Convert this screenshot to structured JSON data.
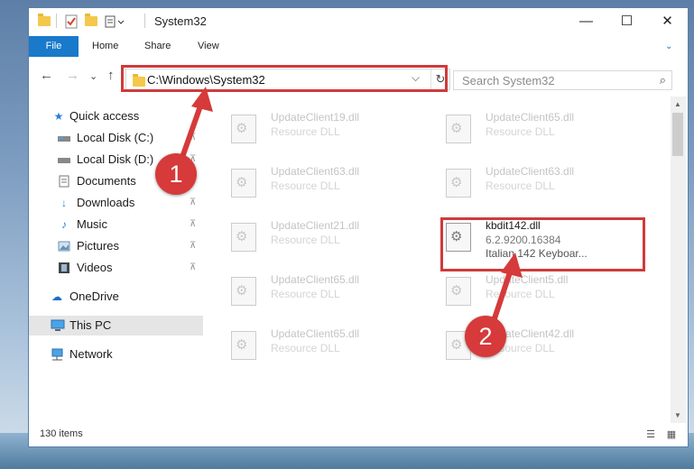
{
  "window": {
    "title": "System32",
    "minimize_glyph": "—",
    "maximize_glyph": "☐",
    "close_glyph": "✕"
  },
  "ribbon": {
    "tabs": [
      "File",
      "Home",
      "Share",
      "View"
    ]
  },
  "address": {
    "path": "C:\\Windows\\System32",
    "dropdown_glyph": "⌵",
    "refresh_glyph": "↻",
    "back_glyph": "←",
    "forward_glyph": "→",
    "recent_glyph": "⌄",
    "up_glyph": "↑"
  },
  "search": {
    "placeholder": "Search System32",
    "icon": "search-icon"
  },
  "navpane": {
    "items": [
      {
        "label": "Quick access",
        "icon": "star-icon",
        "pinned": false
      },
      {
        "label": "Local Disk (C:)",
        "icon": "drive-icon",
        "pinned": true
      },
      {
        "label": "Local Disk (D:)",
        "icon": "drive-icon",
        "pinned": true
      },
      {
        "label": "Documents",
        "icon": "documents-icon",
        "pinned": true
      },
      {
        "label": "Downloads",
        "icon": "download-icon",
        "pinned": true
      },
      {
        "label": "Music",
        "icon": "music-icon",
        "pinned": true
      },
      {
        "label": "Pictures",
        "icon": "pictures-icon",
        "pinned": true
      },
      {
        "label": "Videos",
        "icon": "videos-icon",
        "pinned": true
      },
      {
        "label": "OneDrive",
        "icon": "cloud-icon",
        "pinned": false
      },
      {
        "label": "This PC",
        "icon": "computer-icon",
        "pinned": false,
        "selected": true
      },
      {
        "label": "Network",
        "icon": "network-icon",
        "pinned": false
      }
    ],
    "pin_glyph": "📌"
  },
  "files": {
    "left": [
      {
        "name": "UpdateClient19.dll",
        "type": "Resource DLL"
      },
      {
        "name": "UpdateClient63.dll",
        "type": "Resource DLL"
      },
      {
        "name": "UpdateClient21.dll",
        "type": "Resource DLL"
      },
      {
        "name": "UpdateClient65.dll",
        "type": "Resource DLL"
      },
      {
        "name": "UpdateClient65.dll",
        "type": "Resource DLL"
      }
    ],
    "right": [
      {
        "name": "UpdateClient65.dll",
        "type": "Resource DLL"
      },
      {
        "name": "UpdateClient63.dll",
        "type": "Resource DLL"
      },
      {
        "name": "kbdit142.dll",
        "type": "6.2.9200.16384",
        "desc": "Italian 142 Keyboar..."
      },
      {
        "name": "UpdateClient5.dll",
        "type": "Resource DLL"
      },
      {
        "name": "UpdateClient42.dll",
        "type": "Resource DLL"
      }
    ]
  },
  "status": {
    "count": "130 items"
  },
  "annotations": {
    "step1": "1",
    "step2": "2",
    "highlight_color": "#d03a3a"
  },
  "colors": {
    "file_tab": "#1979ca",
    "folder": "#f4c84a",
    "selected_nav": "#e5e5e5"
  }
}
